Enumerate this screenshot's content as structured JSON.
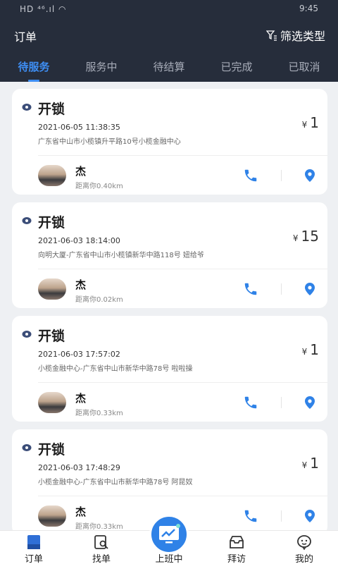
{
  "status_bar": {
    "left": "HD ⁴⁶.ıl ◠",
    "time": "9:45"
  },
  "header": {
    "title": "订单",
    "filter_label": "筛选类型"
  },
  "tabs": [
    {
      "label": "待服务",
      "active": true
    },
    {
      "label": "服务中"
    },
    {
      "label": "待结算"
    },
    {
      "label": "已完成"
    },
    {
      "label": "已取消"
    }
  ],
  "orders": [
    {
      "service": "开锁",
      "time": "2021-06-05 11:38:35",
      "address": "广东省中山市小榄镇升平路10号小榄金融中心",
      "currency": "¥",
      "price": "1",
      "user": "杰",
      "distance": "距离你0.40km"
    },
    {
      "service": "开锁",
      "time": "2021-06-03 18:14:00",
      "address": "向明大厦-广东省中山市小榄镇新华中路118号    妞给爷",
      "currency": "¥",
      "price": "15",
      "user": "杰",
      "distance": "距离你0.02km"
    },
    {
      "service": "开锁",
      "time": "2021-06-03 17:57:02",
      "address": "小榄金融中心-广东省中山市新华中路78号    啦啦操",
      "currency": "¥",
      "price": "1",
      "user": "杰",
      "distance": "距离你0.33km"
    },
    {
      "service": "开锁",
      "time": "2021-06-03 17:48:29",
      "address": "小榄金融中心-广东省中山市新华中路78号    阿昆奴",
      "currency": "¥",
      "price": "1",
      "user": "杰",
      "distance": "距离你0.33km"
    }
  ],
  "tabbar": [
    {
      "label": "订单",
      "icon": "orders-icon"
    },
    {
      "label": "找单",
      "icon": "find-order-icon"
    },
    {
      "label": "上班中",
      "icon": "on-duty-icon"
    },
    {
      "label": "拜访",
      "icon": "visit-icon"
    },
    {
      "label": "我的",
      "icon": "profile-icon"
    }
  ],
  "colors": {
    "header_bg": "#262d3b",
    "accent": "#3e8ef3",
    "background": "#eef0f3"
  }
}
